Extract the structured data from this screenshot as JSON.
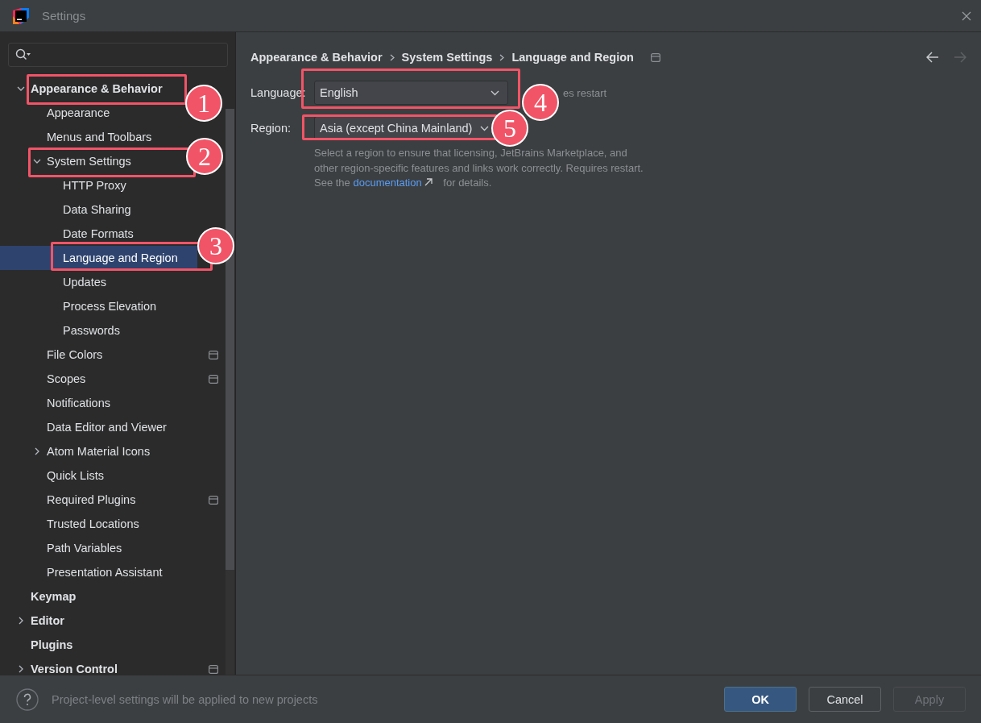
{
  "window": {
    "title": "Settings"
  },
  "tree": [
    {
      "label": "Appearance & Behavior",
      "selected": false,
      "project_level": false,
      "expanded": true,
      "callout": "1",
      "children": [
        {
          "label": "Appearance",
          "selected": false,
          "project_level": false
        },
        {
          "label": "Menus and Toolbars",
          "selected": false,
          "project_level": false
        },
        {
          "label": "System Settings",
          "selected": false,
          "project_level": false,
          "expanded": true,
          "callout": "2",
          "children": [
            {
              "label": "HTTP Proxy",
              "selected": false,
              "project_level": false
            },
            {
              "label": "Data Sharing",
              "selected": false,
              "project_level": false
            },
            {
              "label": "Date Formats",
              "selected": false,
              "project_level": false
            },
            {
              "label": "Language and Region",
              "selected": true,
              "project_level": false,
              "callout": "3"
            },
            {
              "label": "Updates",
              "selected": false,
              "project_level": false
            },
            {
              "label": "Process Elevation",
              "selected": false,
              "project_level": false
            },
            {
              "label": "Passwords",
              "selected": false,
              "project_level": false
            }
          ]
        },
        {
          "label": "File Colors",
          "selected": false,
          "project_level": true
        },
        {
          "label": "Scopes",
          "selected": false,
          "project_level": true
        },
        {
          "label": "Notifications",
          "selected": false,
          "project_level": false
        },
        {
          "label": "Data Editor and Viewer",
          "selected": false,
          "project_level": false
        },
        {
          "label": "Atom Material Icons",
          "selected": false,
          "project_level": false,
          "expanded": false
        },
        {
          "label": "Quick Lists",
          "selected": false,
          "project_level": false
        },
        {
          "label": "Required Plugins",
          "selected": false,
          "project_level": true
        },
        {
          "label": "Trusted Locations",
          "selected": false,
          "project_level": false
        },
        {
          "label": "Path Variables",
          "selected": false,
          "project_level": false
        },
        {
          "label": "Presentation Assistant",
          "selected": false,
          "project_level": false
        }
      ]
    },
    {
      "label": "Keymap",
      "selected": false,
      "project_level": false
    },
    {
      "label": "Editor",
      "selected": false,
      "project_level": false,
      "expanded": false
    },
    {
      "label": "Plugins",
      "selected": false,
      "project_level": false
    },
    {
      "label": "Version Control",
      "selected": false,
      "project_level": true,
      "expanded": false
    }
  ],
  "breadcrumb": [
    "Appearance & Behavior",
    "System Settings",
    "Language and Region"
  ],
  "fields": [
    {
      "label": "Language:",
      "value": "English",
      "hint": "es restart",
      "callout": "4"
    },
    {
      "label": "Region:",
      "value": "Asia (except China Mainland)",
      "callout": "5"
    }
  ],
  "description": {
    "text": "Select a region to ensure that licensing, JetBrains Marketplace, and other region-specific features and links work correctly. Requires restart. See the",
    "link": "documentation",
    "after": "for details."
  },
  "footer": {
    "message": "Project-level settings will be applied to new projects",
    "buttons": [
      {
        "label": "OK",
        "kind": "default",
        "disabled": false
      },
      {
        "label": "Cancel",
        "kind": "normal",
        "disabled": false
      },
      {
        "label": "Apply",
        "kind": "normal",
        "disabled": true
      }
    ]
  }
}
